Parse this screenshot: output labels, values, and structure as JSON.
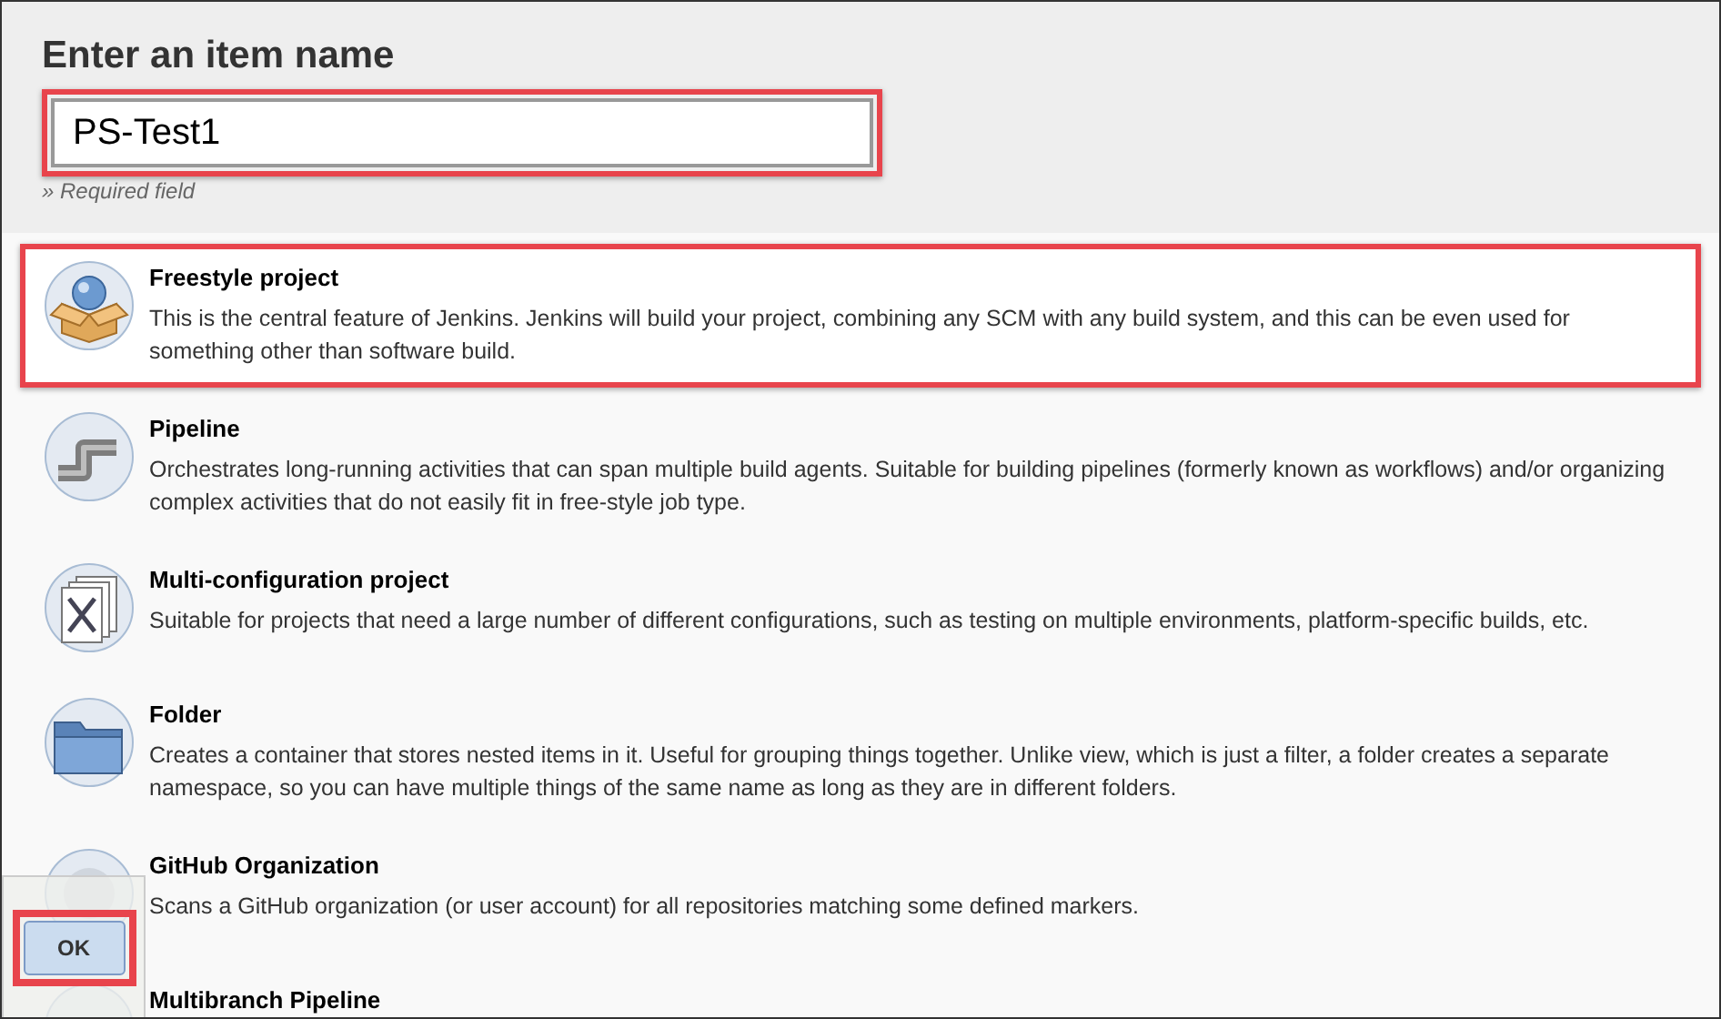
{
  "heading": "Enter an item name",
  "name_field": {
    "value": "PS-Test1",
    "annotated": true
  },
  "hint": "» Required field",
  "items": [
    {
      "kind": "box",
      "title": "Freestyle project",
      "description": "This is the central feature of Jenkins. Jenkins will build your project, combining any SCM with any build system, and this can be even used for something other than software build.",
      "selected": true
    },
    {
      "kind": "pipe",
      "title": "Pipeline",
      "description": "Orchestrates long-running activities that can span multiple build agents. Suitable for building pipelines (formerly known as workflows) and/or organizing complex activities that do not easily fit in free-style job type.",
      "selected": false
    },
    {
      "kind": "stack",
      "title": "Multi-configuration project",
      "description": "Suitable for projects that need a large number of different configurations, such as testing on multiple environments, platform-specific builds, etc.",
      "selected": false
    },
    {
      "kind": "folder",
      "title": "Folder",
      "description": "Creates a container that stores nested items in it. Useful for grouping things together. Unlike view, which is just a filter, a folder creates a separate namespace, so you can have multiple things of the same name as long as they are in different folders.",
      "selected": false
    },
    {
      "kind": "org",
      "title": "GitHub Organization",
      "description": "Scans a GitHub organization (or user account) for all repositories matching some defined markers.",
      "selected": false
    },
    {
      "kind": "branch",
      "title": "Multibranch Pipeline",
      "selected": false
    }
  ],
  "ok_button": {
    "label": "OK",
    "annotated": true
  }
}
